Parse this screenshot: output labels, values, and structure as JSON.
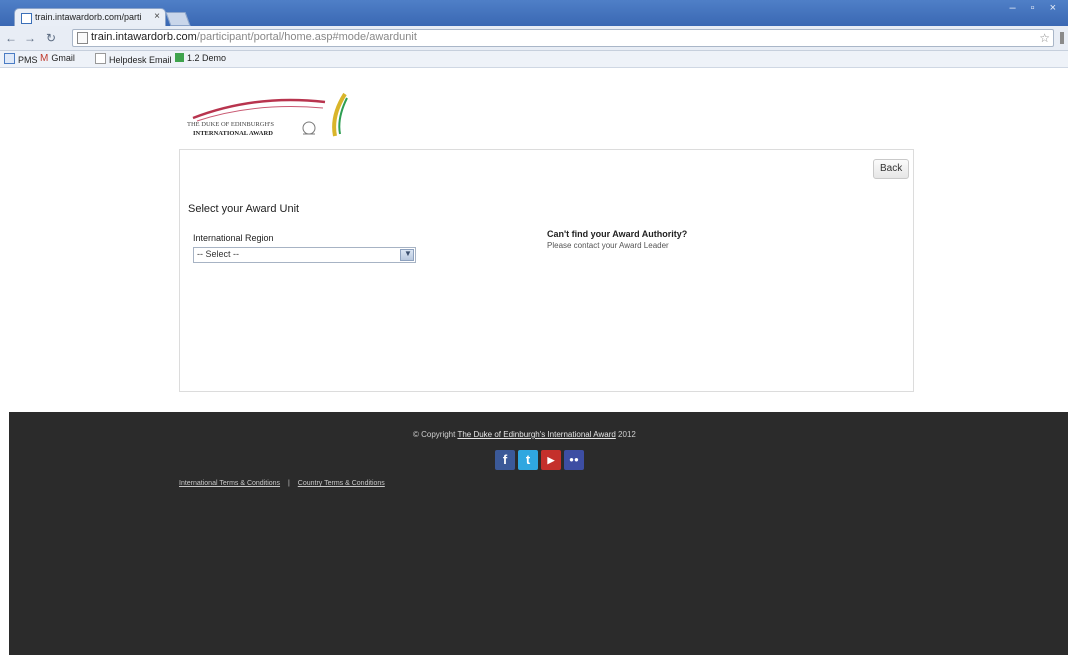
{
  "browser": {
    "tab_title": "train.intawardorb.com/parti",
    "tab_close": "×",
    "url_host": "train.intawardorb.com",
    "url_path": "/participant/portal/home.asp#mode/awardunit",
    "window_controls": "– ▫ ×",
    "bookmarks": [
      {
        "label": "PMS"
      },
      {
        "label": "Gmail"
      },
      {
        "label": "Helpdesk Email"
      },
      {
        "label": "1.2 Demo"
      }
    ]
  },
  "page": {
    "back_label": "Back",
    "heading": "Select your Award Unit",
    "region_label": "International Region",
    "region_select_value": "-- Select --",
    "help_title": "Can't find your Award Authority?",
    "help_text": "Please contact your Award Leader"
  },
  "logo": {
    "line1": "THE DUKE OF EDINBURGH'S",
    "line2": "INTERNATIONAL AWARD"
  },
  "footer": {
    "copyright_prefix": "© Copyright",
    "copyright_link": "The Duke of Edinburgh's International Award",
    "copyright_year": "2012",
    "terms_international": "International Terms & Conditions",
    "terms_separator": "|",
    "terms_country": "Country Terms & Conditions",
    "social": [
      {
        "name": "facebook",
        "glyph": "f",
        "color": "#3b5998"
      },
      {
        "name": "twitter",
        "glyph": "t",
        "color": "#2fa7e0"
      },
      {
        "name": "youtube",
        "glyph": "▶",
        "color": "#c4302b"
      },
      {
        "name": "flickr",
        "glyph": "●●",
        "color": "#3d4ea3"
      }
    ]
  }
}
